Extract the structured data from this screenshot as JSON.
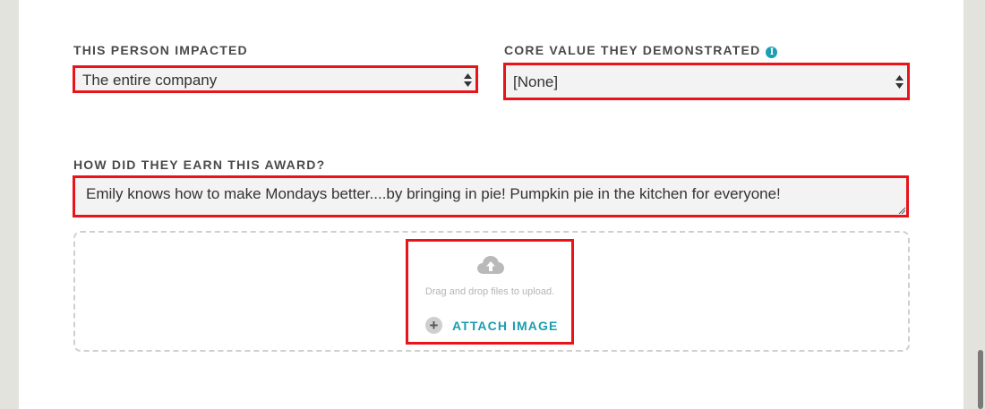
{
  "impacted": {
    "label": "THIS PERSON IMPACTED",
    "value": "The entire company"
  },
  "core_value": {
    "label": "CORE VALUE THEY DEMONSTRATED",
    "info_icon": "info-icon",
    "value": "[None]"
  },
  "award": {
    "label": "HOW DID THEY EARN THIS AWARD?",
    "text": "Emily knows how to make Mondays better....by bringing in pie! Pumpkin pie in the kitchen for everyone!"
  },
  "upload": {
    "icon": "cloud-upload-icon",
    "hint": "Drag and drop files to upload.",
    "attach_icon": "plus-circle-icon",
    "attach_label": "ATTACH IMAGE"
  },
  "colors": {
    "accent": "#1b9eb0",
    "highlight_border": "#e8141a",
    "page_background": "#e3e3de"
  }
}
